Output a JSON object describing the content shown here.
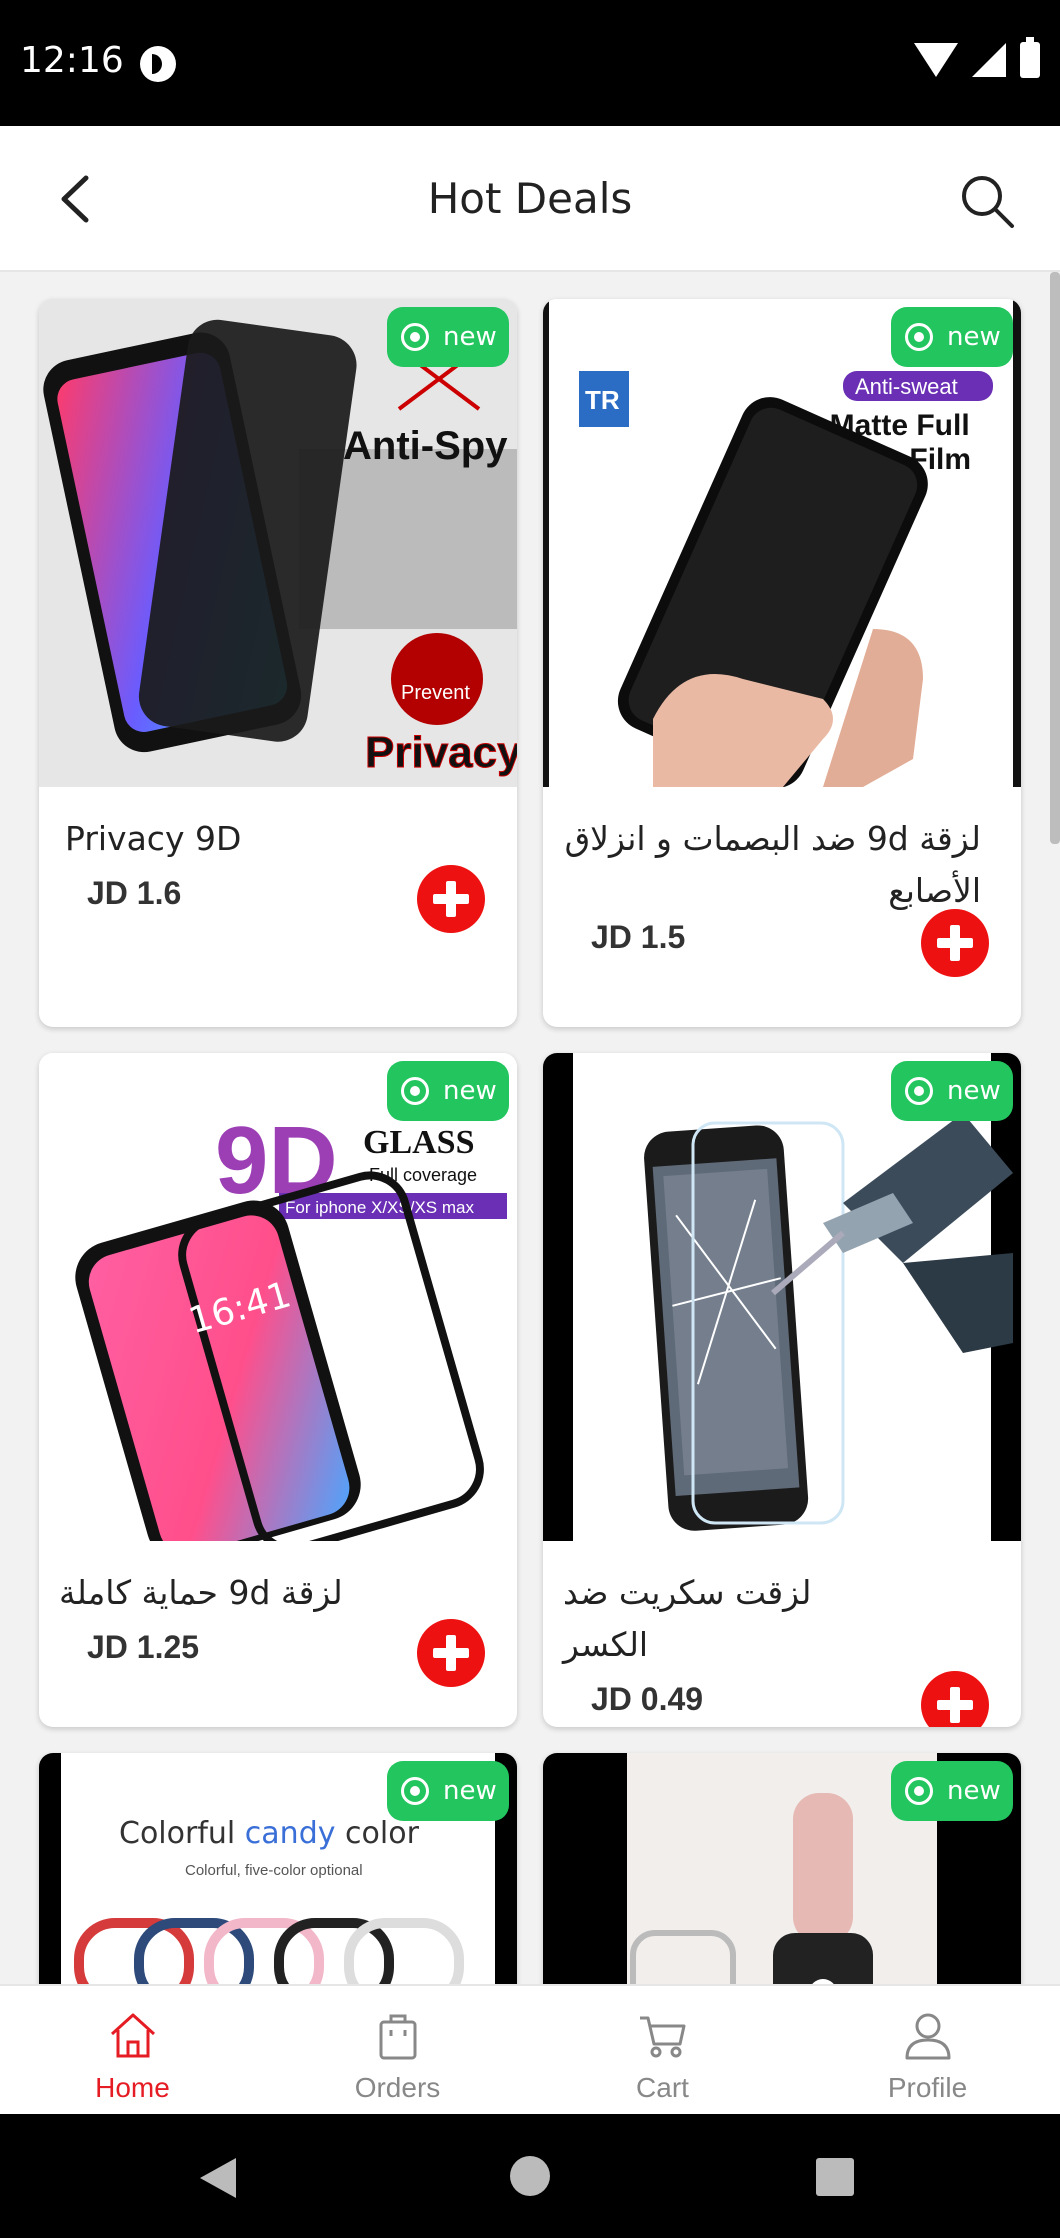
{
  "status_bar": {
    "time": "12:16"
  },
  "header": {
    "title": "Hot Deals"
  },
  "badge_label": "new",
  "products": [
    {
      "title": "Privacy 9D",
      "price": "JD 1.6",
      "image_text": [
        "Anti-Spy",
        "Prevent",
        "Privacy"
      ]
    },
    {
      "title": "لزقة 9d ضد البصمات و انزلاق الأصابع",
      "price": "JD 1.5",
      "image_text": [
        "Anti-sweat",
        "9D Matte Full",
        "Screen Film",
        "TR"
      ]
    },
    {
      "title": "لزقة 9d حماية كاملة",
      "price": "JD 1.25",
      "image_text": [
        "9D",
        "GLASS",
        "Full coverage",
        "For iphone X/XS/XS max",
        "16:41"
      ]
    },
    {
      "title": "لزقت سكريت ضد الكسر",
      "price": "JD 0.49",
      "image_text": []
    },
    {
      "title": "",
      "price": "",
      "image_text": [
        "Colorful",
        "candy",
        "color",
        "Colorful, five-color optional"
      ]
    },
    {
      "title": "",
      "price": "",
      "image_text": []
    }
  ],
  "tabs": [
    {
      "label": "Home",
      "icon": "home-icon",
      "active": true
    },
    {
      "label": "Orders",
      "icon": "bag-icon",
      "active": false
    },
    {
      "label": "Cart",
      "icon": "cart-icon",
      "active": false
    },
    {
      "label": "Profile",
      "icon": "user-icon",
      "active": false
    }
  ],
  "colors": {
    "accent": "#e51c23",
    "badge": "#22c55e",
    "add_button": "#ee1111"
  }
}
